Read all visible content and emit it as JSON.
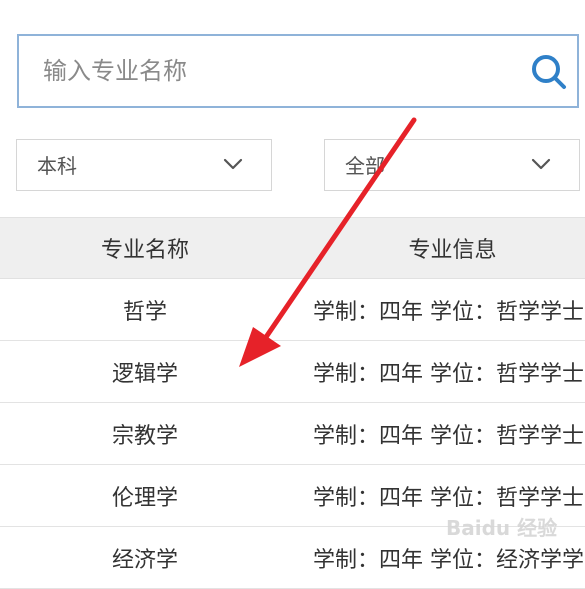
{
  "search": {
    "placeholder": "输入专业名称",
    "value": ""
  },
  "filters": {
    "level": "本科",
    "category": "全部"
  },
  "table": {
    "headers": [
      "专业名称",
      "专业信息"
    ],
    "rows": [
      {
        "name": "哲学",
        "info": "学制：四年 学位：哲学学士"
      },
      {
        "name": "逻辑学",
        "info": "学制：四年 学位：哲学学士"
      },
      {
        "name": "宗教学",
        "info": "学制：四年 学位：哲学学士"
      },
      {
        "name": "伦理学",
        "info": "学制：四年 学位：哲学学士"
      },
      {
        "name": "经济学",
        "info": "学制：四年 学位：经济学学士"
      }
    ]
  },
  "watermark": {
    "text": "Baidu 经验"
  },
  "icons": {
    "search": "search-icon",
    "dropdown": "chevron-down-icon"
  },
  "colors": {
    "search_border": "#8fb3d9",
    "search_icon": "#2f80c8",
    "header_background": "#efefef",
    "arrow": "#e62229"
  }
}
